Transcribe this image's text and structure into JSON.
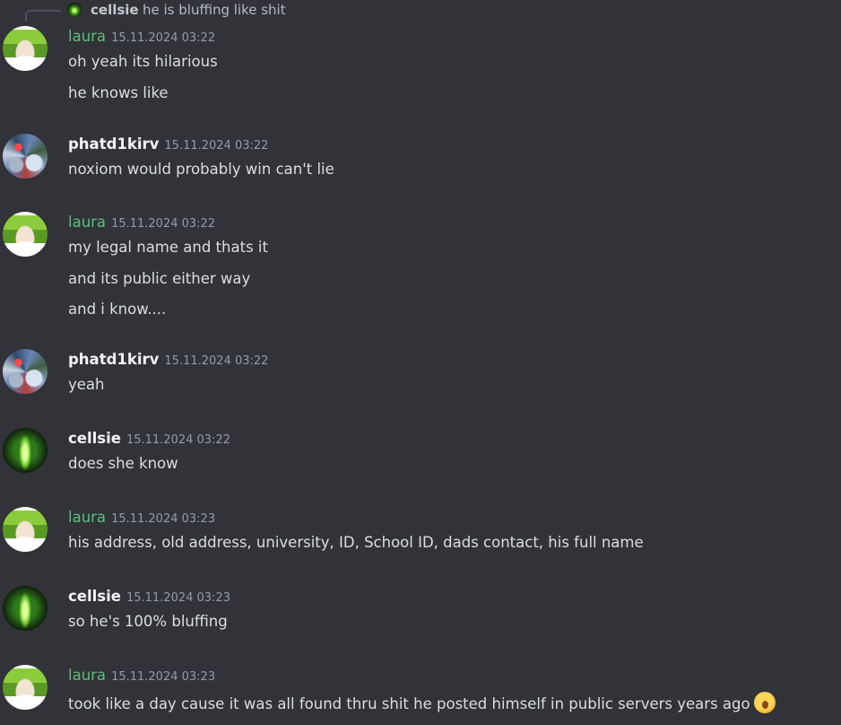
{
  "reply": {
    "author": "cellsie",
    "text": "he is bluffing like shit"
  },
  "messages": [
    {
      "author": "laura",
      "timestamp": "15.11.2024 03:22",
      "lines": [
        "oh yeah its hilarious",
        "he knows like"
      ]
    },
    {
      "author": "phatd1kirv",
      "timestamp": "15.11.2024 03:22",
      "lines": [
        "noxiom would probably win can't lie"
      ]
    },
    {
      "author": "laura",
      "timestamp": "15.11.2024 03:22",
      "lines": [
        "my legal name and thats it",
        "and its public either way",
        "and i know...."
      ]
    },
    {
      "author": "phatd1kirv",
      "timestamp": "15.11.2024 03:22",
      "lines": [
        "yeah"
      ]
    },
    {
      "author": "cellsie",
      "timestamp": "15.11.2024 03:22",
      "lines": [
        "does she know"
      ]
    },
    {
      "author": "laura",
      "timestamp": "15.11.2024 03:23",
      "lines": [
        "his address, old address, university, ID, School ID, dads contact, his full name"
      ]
    },
    {
      "author": "cellsie",
      "timestamp": "15.11.2024 03:23",
      "lines": [
        "so he's 100% bluffing"
      ]
    },
    {
      "author": "laura",
      "timestamp": "15.11.2024 03:23",
      "lines": [
        "took like a day cause it was all found thru shit he posted himself in public servers years ago"
      ],
      "emoji": "yawning-face-emoji"
    }
  ],
  "colors": {
    "background": "#313338",
    "laura_name": "#5dbf7a",
    "default_name": "#f2f3f5",
    "timestamp": "#949ba4",
    "text": "#dbdee1"
  }
}
